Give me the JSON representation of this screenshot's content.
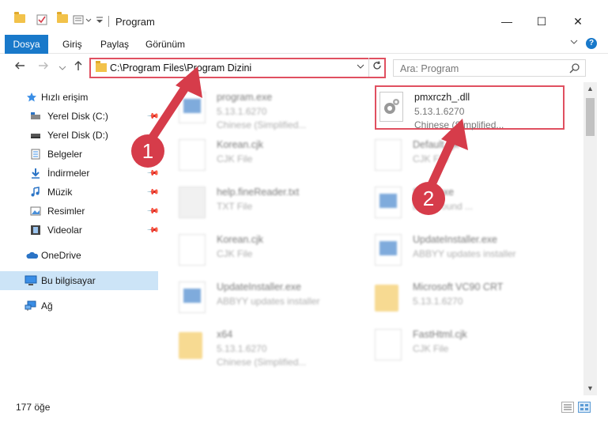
{
  "window": {
    "title": "Program",
    "minimize_glyph": "—",
    "maximize_glyph": "☐",
    "close_glyph": "✕"
  },
  "ribbon": {
    "tabs": [
      "Dosya",
      "Giriş",
      "Paylaş",
      "Görünüm"
    ],
    "help_glyph": "?"
  },
  "address": {
    "path": "C:\\Program Files\\Program Dizini",
    "search_placeholder": "Ara: Program"
  },
  "sidebar": {
    "quick_access": "Hızlı erişim",
    "items": [
      {
        "label": "Yerel Disk (C:)",
        "icon": "drive-icon",
        "pinned": true
      },
      {
        "label": "Yerel Disk (D:)",
        "icon": "drive-icon",
        "pinned": false
      },
      {
        "label": "Belgeler",
        "icon": "documents-icon",
        "pinned": true
      },
      {
        "label": "İndirmeler",
        "icon": "downloads-icon",
        "pinned": true
      },
      {
        "label": "Müzik",
        "icon": "music-icon",
        "pinned": true
      },
      {
        "label": "Resimler",
        "icon": "pictures-icon",
        "pinned": true
      },
      {
        "label": "Videolar",
        "icon": "videos-icon",
        "pinned": true
      }
    ],
    "onedrive": "OneDrive",
    "this_pc": "Bu bilgisayar",
    "network": "Ağ"
  },
  "files": [
    {
      "name": "program.exe",
      "line2": "5.13.1.6270",
      "line3": "Chinese (Simplified...",
      "icon": "exe-icon"
    },
    {
      "name": "pmxrczh_.dll",
      "line2": "5.13.1.6270",
      "line3": "Chinese (Simplified...",
      "icon": "dll-gear-icon"
    },
    {
      "name": "Korean.cjk",
      "line2": "CJK File",
      "line3": "",
      "icon": "document-icon"
    },
    {
      "name": "Default.cjk",
      "line2": "CJK File",
      "line3": "",
      "icon": "document-icon"
    },
    {
      "name": "help.fineReader.txt",
      "line2": "TXT File",
      "line3": "",
      "icon": "text-icon"
    },
    {
      "name": "Spec.exe",
      "line2": "background ...",
      "line3": "",
      "icon": "installer-icon"
    },
    {
      "name": "Korean.cjk",
      "line2": "CJK File",
      "line3": "",
      "icon": "document-icon"
    },
    {
      "name": "UpdateInstaller.exe",
      "line2": "ABBYY updates installer",
      "line3": "",
      "icon": "installer-icon"
    },
    {
      "name": "UpdateInstaller.exe",
      "line2": "ABBYY updates installer",
      "line3": "",
      "icon": "installer-icon"
    },
    {
      "name": "Microsoft VC90 CRT",
      "line2": "5.13.1.6270",
      "line3": "",
      "icon": "folder-icon"
    },
    {
      "name": "x64",
      "line2": "5.13.1.6270",
      "line3": "Chinese (Simplified...",
      "icon": "folder-icon"
    },
    {
      "name": "FastHtml.cjk",
      "line2": "CJK File",
      "line3": "",
      "icon": "document-icon"
    }
  ],
  "status": {
    "item_count": "177 öğe"
  },
  "annotations": {
    "step1": "1",
    "step2": "2",
    "color": "#d63c4a"
  }
}
